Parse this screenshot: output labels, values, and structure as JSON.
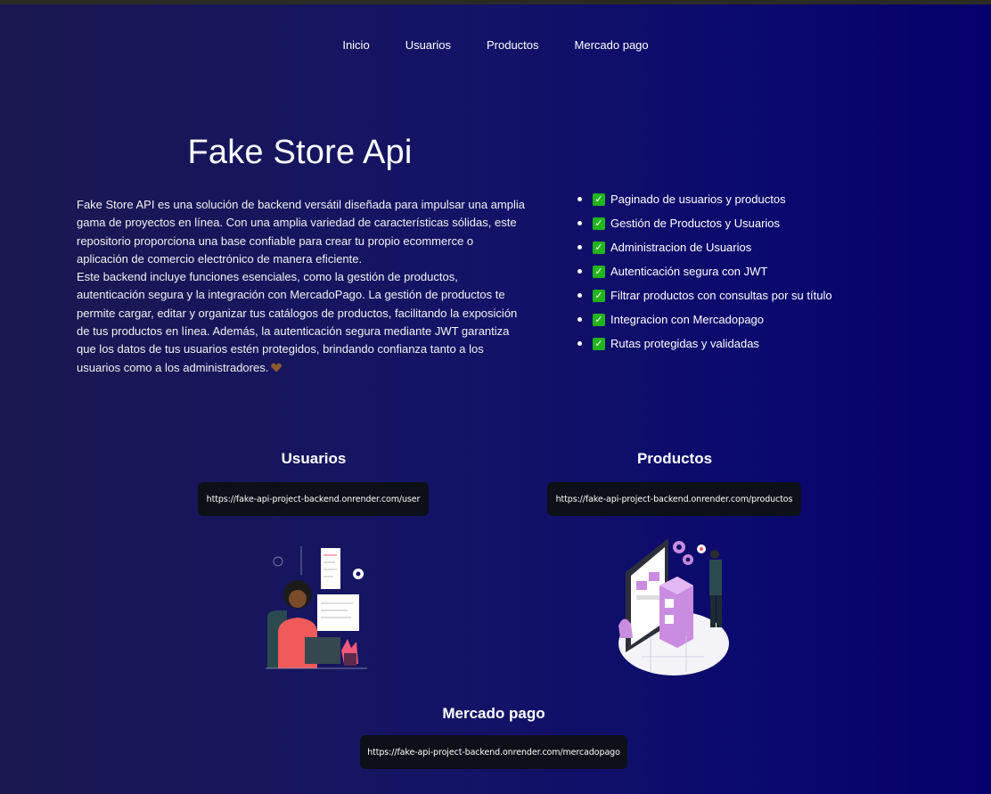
{
  "nav": {
    "items": [
      "Inicio",
      "Usuarios",
      "Productos",
      "Mercado pago"
    ]
  },
  "hero": {
    "title": "Fake Store Api",
    "paragraph_1": "Fake Store API es una solución de backend versátil diseñada para impulsar una amplia gama de proyectos en línea. Con una amplia variedad de características sólidas, este repositorio proporciona una base confiable para crear tu propio ecommerce o aplicación de comercio electrónico de manera eficiente.",
    "paragraph_2": "Este backend incluye funciones esenciales, como la gestión de productos, autenticación segura y la integración con MercadoPago. La gestión de productos te permite cargar, editar y organizar tus catálogos de productos, facilitando la exposición de tus productos en línea. Además, la autenticación segura mediante JWT garantiza que los datos de tus usuarios estén protegidos, brindando confianza tanto a los usuarios como a los administradores."
  },
  "features": [
    "Paginado de usuarios y productos",
    "Gestión de Productos y Usuarios",
    "Administracion de Usuarios",
    "Autenticación segura con JWT",
    "Filtrar productos con consultas por su título",
    "Integracion con Mercadopago",
    "Rutas protegidas y validadas"
  ],
  "endpoints": {
    "usuarios": {
      "title": "Usuarios",
      "url": "https://fake-api-project-backend.onrender.com/user"
    },
    "productos": {
      "title": "Productos",
      "url": "https://fake-api-project-backend.onrender.com/productos"
    },
    "mercadopago": {
      "title": "Mercado pago",
      "url": "https://fake-api-project-backend.onrender.com/mercadopago"
    }
  },
  "icons": {
    "check": "check-mark-icon",
    "heart": "brown-heart-icon"
  },
  "colors": {
    "check_green": "#22b51c",
    "url_box_bg": "#0d1117",
    "accent_pink": "#f05a78",
    "accent_violet": "#c98ce0"
  }
}
